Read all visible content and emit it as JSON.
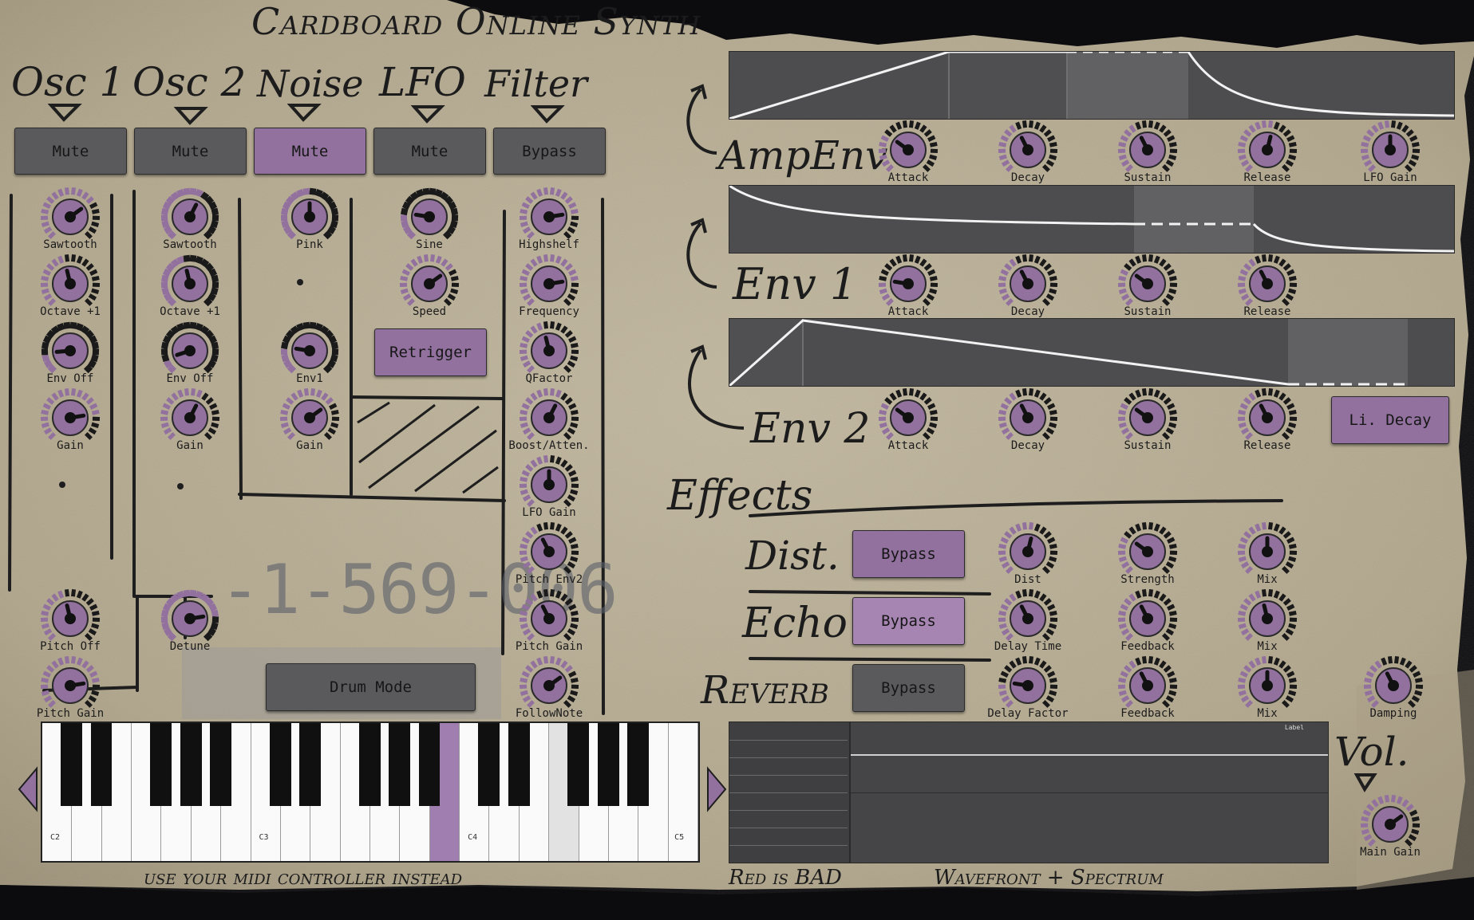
{
  "title": "Cardboard Online Synth",
  "section_titles": {
    "osc1": "Osc 1",
    "osc2": "Osc 2",
    "noise": "Noise",
    "lfo": "LFO",
    "filter": "Filter",
    "amp_env": "AmpEnv",
    "env1": "Env 1",
    "env2": "Env 2",
    "effects": "Effects",
    "dist": "Dist.",
    "echo": "Echo",
    "reverb": "Reverb",
    "vol": "Vol."
  },
  "buttons": {
    "osc1_mute": "Mute",
    "osc2_mute": "Mute",
    "noise_mute": "Mute",
    "lfo_mute": "Mute",
    "filter_bypass": "Bypass",
    "retrigger": "Retrigger",
    "drum_mode": "Drum Mode",
    "li_decay": "Li. Decay",
    "dist_bypass": "Bypass",
    "echo_bypass": "Bypass",
    "reverb_bypass": "Bypass"
  },
  "knob_labels": {
    "osc1": [
      "Sawtooth",
      "Octave +1",
      "Env Off",
      "Gain",
      "Pitch Off",
      "Pitch Gain"
    ],
    "osc2": [
      "Sawtooth",
      "Octave +1",
      "Env Off",
      "Gain",
      "Detune"
    ],
    "noise": [
      "Pink",
      "Env1",
      "Gain"
    ],
    "lfo": [
      "Sine",
      "Speed"
    ],
    "filter": [
      "Highshelf",
      "Frequency",
      "QFactor",
      "Boost/Atten.",
      "LFO Gain",
      "Pitch Env2",
      "Pitch Gain",
      "FollowNote"
    ],
    "amp_env": [
      "Attack",
      "Decay",
      "Sustain",
      "Release",
      "LFO Gain"
    ],
    "env1": [
      "Attack",
      "Decay",
      "Sustain",
      "Release"
    ],
    "env2": [
      "Attack",
      "Decay",
      "Sustain",
      "Release"
    ],
    "dist": [
      "Dist",
      "Strength",
      "Mix"
    ],
    "echo": [
      "Delay Time",
      "Feedback",
      "Mix"
    ],
    "reverb": [
      "Delay Factor",
      "Feedback",
      "Mix",
      "Damping"
    ],
    "vol": [
      "Main Gain"
    ]
  },
  "sticker_number": "-1-569-006",
  "keyboard": {
    "notes": [
      "C2",
      "C3",
      "C4",
      "C5"
    ],
    "caption": "use your midi controller instead"
  },
  "vu_caption": "Red is BAD",
  "scope": {
    "caption": "Wavefront + Spectrum",
    "label": "Label"
  },
  "colors": {
    "purple": "#92719f",
    "button_gray": "#5a5a5c",
    "panel": "#4d4d4f",
    "cardboard": "#b6ab92"
  },
  "icons": [
    "arrow-down-triangle-icon",
    "curved-arrow-icon",
    "left-arrow-icon",
    "right-arrow-icon"
  ]
}
